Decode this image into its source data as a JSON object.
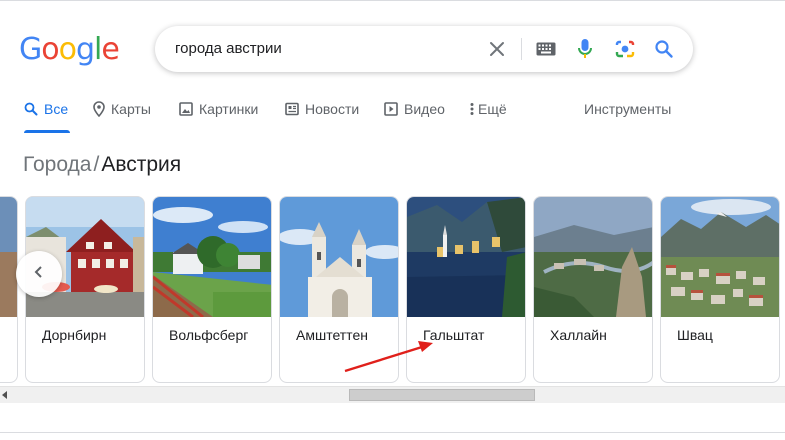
{
  "logo": {
    "letters": [
      "G",
      "o",
      "o",
      "g",
      "l",
      "e"
    ],
    "colors": [
      "#4285F4",
      "#EA4335",
      "#FBBC05",
      "#4285F4",
      "#34A853",
      "#EA4335"
    ]
  },
  "search": {
    "query": "города австрии"
  },
  "icons": {
    "clear": "close-icon",
    "keyboard": "keyboard-icon",
    "mic": "microphone-icon",
    "lens": "camera-lens-icon",
    "search": "search-icon"
  },
  "tabs": [
    {
      "label": "Все",
      "icon": "search-icon",
      "active": true
    },
    {
      "label": "Карты",
      "icon": "map-pin-icon"
    },
    {
      "label": "Картинки",
      "icon": "image-icon"
    },
    {
      "label": "Новости",
      "icon": "news-icon"
    },
    {
      "label": "Видео",
      "icon": "play-icon"
    },
    {
      "label": "Ещё",
      "icon": "more-vert-icon"
    }
  ],
  "tools_label": "Инструменты",
  "breadcrumb": {
    "parent": "Города",
    "separator": "/",
    "current": "Австрия"
  },
  "cards": [
    {
      "name": "Дорнбирн"
    },
    {
      "name": "Вольфсберг"
    },
    {
      "name": "Амштеттен"
    },
    {
      "name": "Гальштат"
    },
    {
      "name": "Халлайн"
    },
    {
      "name": "Швац"
    }
  ],
  "colors": {
    "accent": "#1a73e8",
    "annotation": "#e0201b"
  }
}
